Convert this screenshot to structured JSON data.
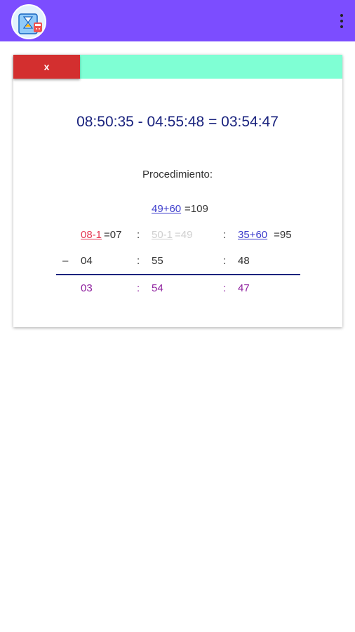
{
  "appbar": {
    "icon": "hourglass-calculator-icon",
    "menu_icon": "more-vert-icon",
    "color": "#7c4dff"
  },
  "dialog": {
    "close_label": "x",
    "header_color": "#7fffd4",
    "close_color": "#d32f2f",
    "result": "08:50:35 - 04:55:48 = 03:54:47",
    "procedure_title": "Procedimiento:",
    "carry_seconds": {
      "expr": "49+60",
      "result": "=109"
    },
    "row_borrow": {
      "hours": {
        "expr": "08-1",
        "result": "=07"
      },
      "minutes": {
        "expr": "50-1",
        "result": "=49"
      },
      "seconds": {
        "expr": "35+60",
        "result": " =95"
      }
    },
    "minus_sign": "–",
    "subtrahend": {
      "hours": "04",
      "minutes": "55",
      "seconds": "48"
    },
    "difference": {
      "hours": "03",
      "minutes": "54",
      "seconds": "47"
    },
    "separator": ":"
  }
}
